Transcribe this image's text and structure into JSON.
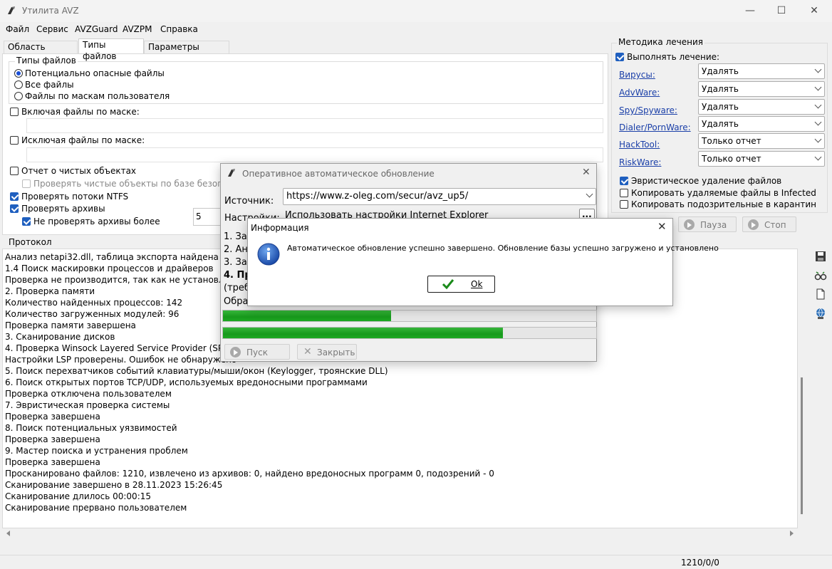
{
  "window": {
    "title": "Утилита AVZ",
    "minimize": "—",
    "maximize": "☐",
    "close": "✕"
  },
  "menu": [
    "Файл",
    "Сервис",
    "AVZGuard",
    "AVZPM",
    "Справка"
  ],
  "tabs": [
    "Область поиска",
    "Типы файлов",
    "Параметры поиска"
  ],
  "active_tab": "Типы файлов",
  "file_types": {
    "legend": "Типы файлов",
    "options": [
      "Потенциально опасные файлы",
      "Все файлы",
      "Файлы по маскам пользователя"
    ],
    "selected": "Потенциально опасные файлы"
  },
  "include_mask": {
    "label": "Включая файлы по маске:",
    "value": ""
  },
  "exclude_mask": {
    "label": "Исключая файлы по маске:",
    "value": ""
  },
  "checks": {
    "clean_report": "Отчет о чистых объектах",
    "check_clean_db": "Проверять чистые объекты по базе безопасных",
    "ntfs_streams": "Проверять потоки NTFS",
    "archives": "Проверять архивы",
    "skip_archives": "Не проверять архивы более",
    "skip_archives_value": "5"
  },
  "treatment": {
    "legend": "Методика лечения",
    "perform": "Выполнять лечение:",
    "rows": [
      {
        "label": "Вирусы:",
        "value": "Удалять"
      },
      {
        "label": "AdvWare:",
        "value": "Удалять"
      },
      {
        "label": "Spy/Spyware:",
        "value": "Удалять"
      },
      {
        "label": "Dialer/PornWare:",
        "value": "Удалять"
      },
      {
        "label": "HackTool:",
        "value": "Только отчет"
      },
      {
        "label": "RiskWare:",
        "value": "Только отчет"
      }
    ],
    "heuristic": "Эвристическое удаление файлов",
    "copy_deleted": "Копировать удаляемые файлы в  Infected",
    "copy_suspicious": "Копировать подозрительные в  карантин"
  },
  "controls": {
    "pause": "Пауза",
    "stop": "Стоп"
  },
  "protocol": {
    "label": "Протокол",
    "lines": [
      " Анализ netapi32.dll, таблица экспорта найдена в с",
      "1.4 Поиск маскировки процессов и драйверов",
      " Проверка не производится, так как не установлен",
      "2. Проверка памяти",
      " Количество найденных процессов: 142",
      " Количество загруженных модулей: 96",
      "Проверка памяти завершена",
      "3. Сканирование дисков",
      "4. Проверка Winsock Layered Service Provider (SPI/L",
      " Настройки LSP проверены. Ошибок не обнаружено",
      "5. Поиск перехватчиков событий клавиатуры/мыши/окон (Keylogger, троянские DLL)",
      "6. Поиск открытых портов TCP/UDP, используемых вредоносными программами",
      " Проверка отключена пользователем",
      "7. Эвристическая проверка системы",
      "Проверка завершена",
      "8. Поиск потенциальных уязвимостей",
      "Проверка завершена",
      "9. Мастер поиска и устранения проблем",
      "Проверка завершена",
      "Просканировано файлов: 1210, извлечено из архивов: 0, найдено вредоносных программ 0, подозрений - 0",
      "Сканирование завершено в 28.11.2023 15:26:45",
      "Сканирование длилось 00:00:15",
      "Сканирование прервано пользователем"
    ]
  },
  "status": {
    "counts": "1210/0/0"
  },
  "update_dialog": {
    "title": "Оперативное автоматическое обновление",
    "source_label": "Источник:",
    "source_value": "https://www.z-oleg.com/secur/avz_up5/",
    "settings_label": "Настройки:",
    "settings_value": "Использовать настройки Internet Explorer",
    "browse": "...",
    "steps": [
      "1. Заг",
      "2. Ана",
      "3. Заг",
      "4. Пр",
      "(требу"
    ],
    "processing_label": "Обраб",
    "progress1": 0.45,
    "progress2": 0.75,
    "start": "Пуск",
    "close": "Закрыть"
  },
  "info_dialog": {
    "title": "Информация",
    "message": "Автоматическое обновление успешно завершено. Обновление базы успешно загружено и установлено",
    "ok": "Ok"
  }
}
